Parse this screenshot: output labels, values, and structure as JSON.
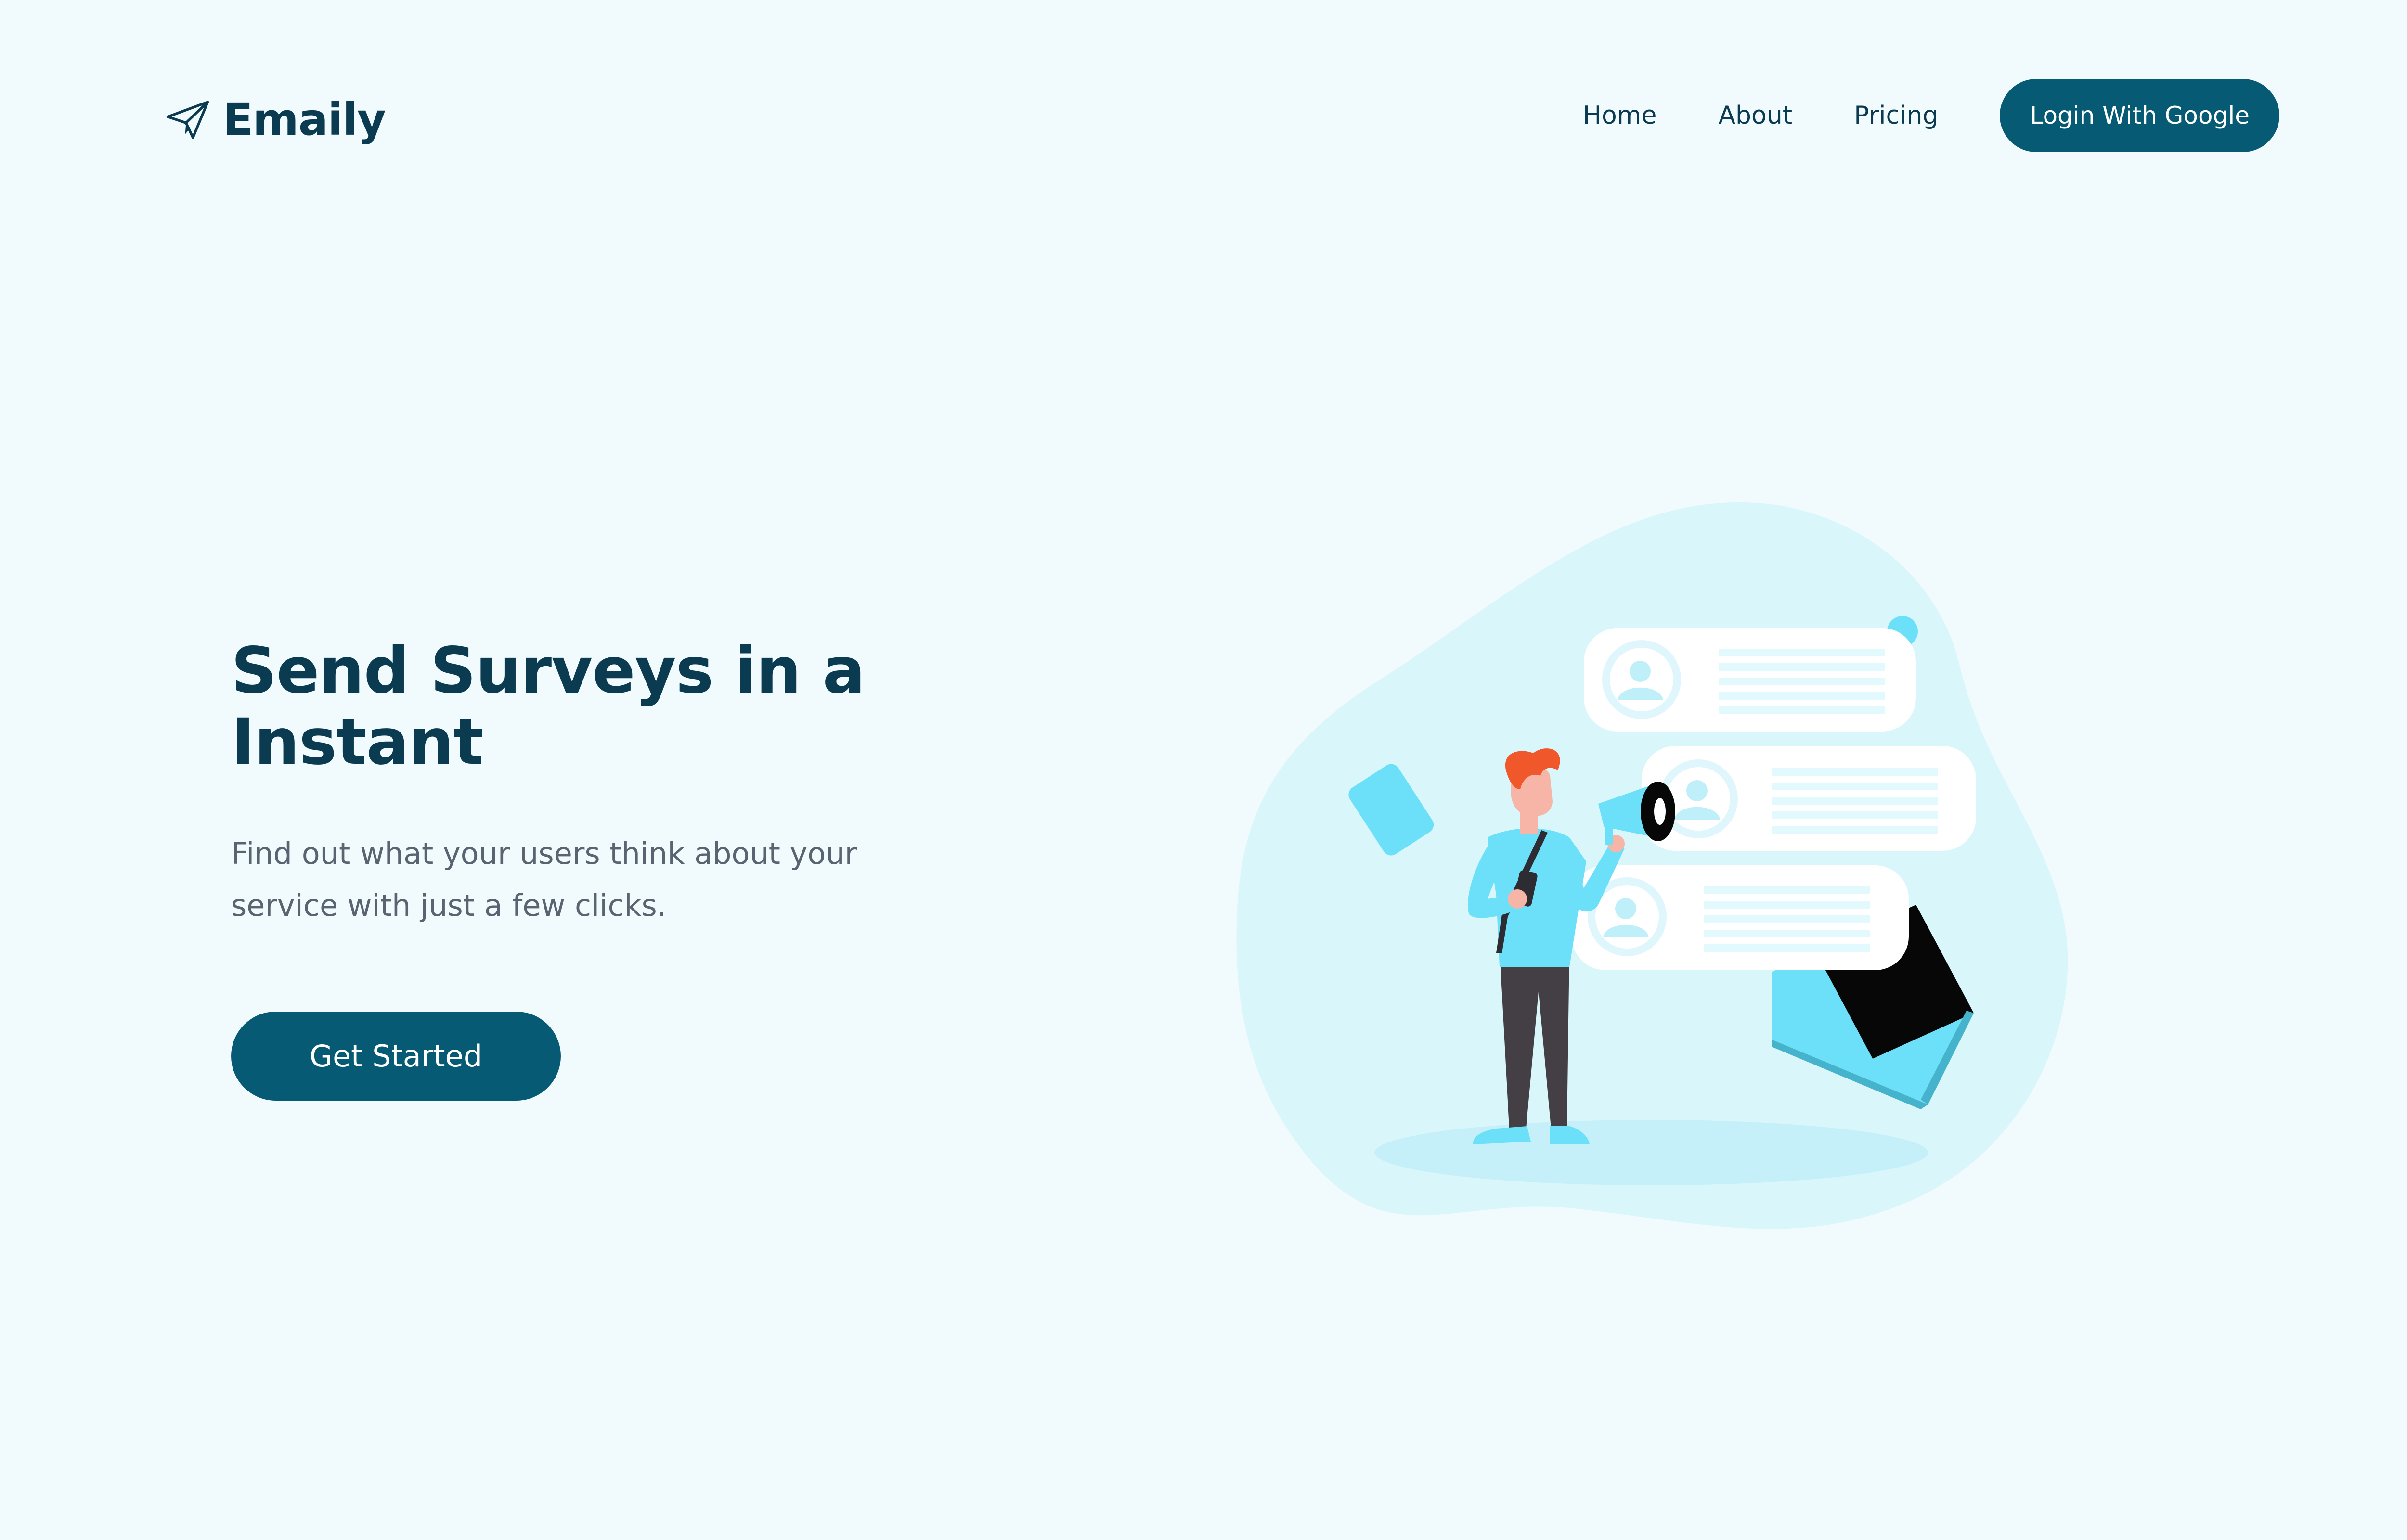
{
  "header": {
    "brand": "Emaily",
    "brand_icon": "paper-plane-icon",
    "nav": [
      {
        "label": "Home"
      },
      {
        "label": "About"
      },
      {
        "label": "Pricing"
      }
    ],
    "login_label": "Login With Google"
  },
  "hero": {
    "title_line1": "Send Surveys in a",
    "title_line2": "Instant",
    "subtitle_line1": "Find out what your users think about your",
    "subtitle_line2": "service with just a few clicks.",
    "cta_label": "Get Started"
  },
  "illustration": {
    "subject": "person-with-megaphone-illustration",
    "colors": {
      "blob": "#d9f6fb",
      "accent": "#6ce0f8",
      "card": "#ffffff",
      "dark": "#070707"
    }
  },
  "colors": {
    "background": "#f1fbfd",
    "primary": "#075a73",
    "heading": "#0b3b51",
    "body_text": "#5a6470"
  }
}
